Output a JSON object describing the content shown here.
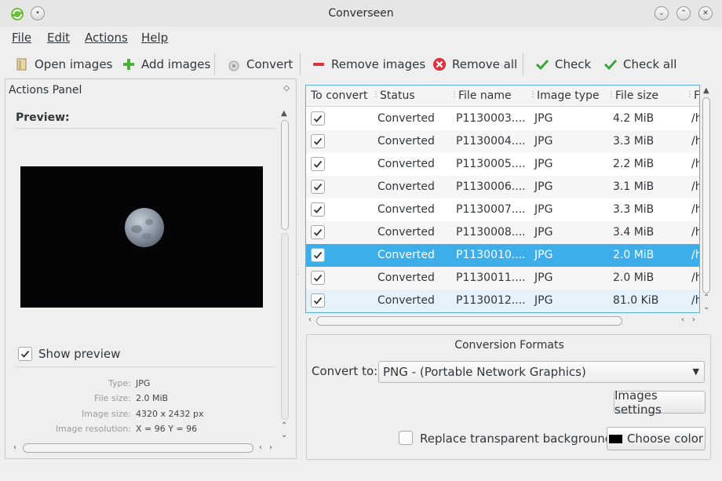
{
  "window": {
    "title": "Converseen"
  },
  "menu": [
    "File",
    "Edit",
    "Actions",
    "Help"
  ],
  "toolbar": {
    "open_images": "Open images",
    "add_images": "Add images",
    "convert": "Convert",
    "remove_images": "Remove images",
    "remove_all": "Remove all",
    "check": "Check",
    "check_all": "Check all"
  },
  "actions_panel": {
    "title": "Actions Panel",
    "preview_label": "Preview:",
    "show_preview_label": "Show preview",
    "show_preview_checked": true,
    "info": [
      {
        "key": "Type:",
        "value": "JPG"
      },
      {
        "key": "File size:",
        "value": "2.0 MiB"
      },
      {
        "key": "Image size:",
        "value": "4320 x 2432 px"
      },
      {
        "key": "Image resolution:",
        "value": "X = 96 Y = 96"
      }
    ]
  },
  "table": {
    "columns": [
      "To convert",
      "Status",
      "File name",
      "Image type",
      "File size",
      "F"
    ],
    "rows": [
      {
        "checked": true,
        "status": "Converted",
        "file": "P1130003....",
        "type": "JPG",
        "size": "4.2 MiB",
        "path": "/h"
      },
      {
        "checked": true,
        "status": "Converted",
        "file": "P1130004....",
        "type": "JPG",
        "size": "3.3 MiB",
        "path": "/h"
      },
      {
        "checked": true,
        "status": "Converted",
        "file": "P1130005....",
        "type": "JPG",
        "size": "2.2 MiB",
        "path": "/h"
      },
      {
        "checked": true,
        "status": "Converted",
        "file": "P1130006....",
        "type": "JPG",
        "size": "3.1 MiB",
        "path": "/h"
      },
      {
        "checked": true,
        "status": "Converted",
        "file": "P1130007....",
        "type": "JPG",
        "size": "3.3 MiB",
        "path": "/h"
      },
      {
        "checked": true,
        "status": "Converted",
        "file": "P1130008....",
        "type": "JPG",
        "size": "3.4 MiB",
        "path": "/h"
      },
      {
        "checked": true,
        "status": "Converted",
        "file": "P1130010....",
        "type": "JPG",
        "size": "2.0 MiB",
        "path": "/h"
      },
      {
        "checked": true,
        "status": "Converted",
        "file": "P1130011....",
        "type": "JPG",
        "size": "2.0 MiB",
        "path": "/h"
      },
      {
        "checked": true,
        "status": "Converted",
        "file": "P1130012....",
        "type": "JPG",
        "size": "81.0 KiB",
        "path": "/h"
      }
    ]
  },
  "conversion": {
    "title": "Conversion Formats",
    "convert_to_label": "Convert to:",
    "format_value": "PNG - (Portable Network Graphics)",
    "images_settings": "Images settings",
    "replace_label": "Replace transparent background",
    "replace_checked": false,
    "choose_color": "Choose color",
    "swatch_color": "#000000"
  },
  "colors": {
    "selection": "#3daee9",
    "focus_border": "#5aaee3"
  }
}
